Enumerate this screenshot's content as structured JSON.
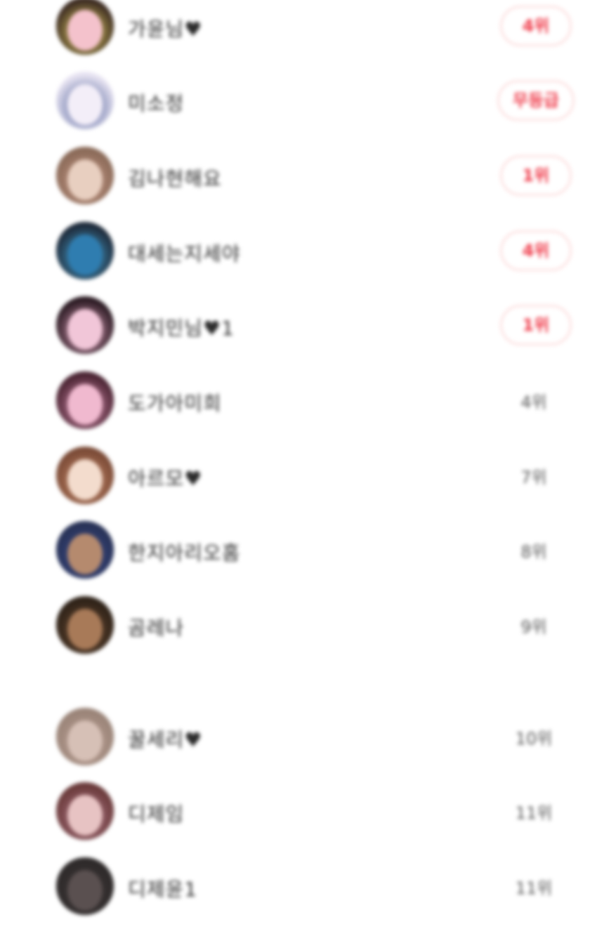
{
  "rows": [
    {
      "name": "가윤님♥",
      "rank": "4위",
      "badge": true,
      "hair": "#3b2a22",
      "face": "#f4c2cc",
      "accent": "#f6e36a"
    },
    {
      "name": "미소정",
      "rank": "무등급",
      "badge": true,
      "wide": true,
      "hair": "#e8e4f2",
      "face": "#f3eef8",
      "accent": "#3a4d8c"
    },
    {
      "name": "김나현해요",
      "rank": "1위",
      "badge": true,
      "hair": "#8a6a58",
      "face": "#e8cfc0",
      "accent": "#c99a88"
    },
    {
      "name": "대세는지세야",
      "rank": "4위",
      "badge": true,
      "hair": "#1e2a3a",
      "face": "#2f7db0",
      "accent": "#49a9d8"
    },
    {
      "name": "박지민님♥1",
      "rank": "1위",
      "badge": true,
      "hair": "#2a1a22",
      "face": "#f1c6d8",
      "accent": "#e9a8c4"
    },
    {
      "name": "도가아미희",
      "rank": "4위",
      "badge": false,
      "hair": "#4a2432",
      "face": "#f0b9cf",
      "accent": "#d88fb0"
    },
    {
      "name": "아르모♥",
      "rank": "7위",
      "badge": false,
      "hair": "#7a4a36",
      "face": "#f3dccd",
      "accent": "#c88a6a"
    },
    {
      "name": "한지아리오홈",
      "rank": "8위",
      "badge": false,
      "hair": "#283256",
      "face": "#b58a6e",
      "accent": "#3a4a8a"
    },
    {
      "name": "곰레나",
      "rank": "9위",
      "badge": false,
      "hair": "#2e2218",
      "face": "#a87a58",
      "accent": "#6a4a32"
    },
    {
      "name": "꿀세리♥",
      "rank": "10위",
      "badge": false,
      "hair": "#9a8478",
      "face": "#d6c0b6",
      "accent": "#bba095"
    },
    {
      "name": "디제임",
      "rank": "11위",
      "badge": false,
      "hair": "#6a3a3a",
      "face": "#e7c3c3",
      "accent": "#b07a8a"
    },
    {
      "name": "디제윤1",
      "rank": "11위",
      "badge": false,
      "hair": "#2e2a2a",
      "face": "#5a5050",
      "accent": "#3c3636"
    }
  ],
  "colors": {
    "accent_red": "#ef3b4a",
    "badge_border": "#fde0e0",
    "text": "#2a2a2a",
    "muted": "#555555"
  }
}
